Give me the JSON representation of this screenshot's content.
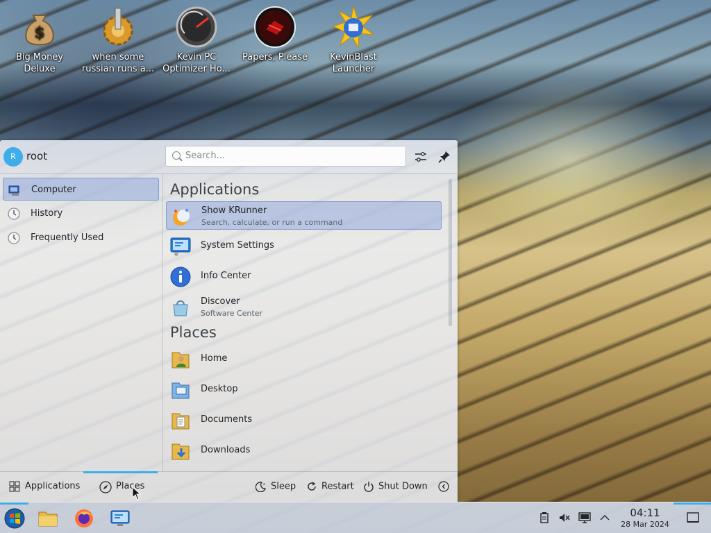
{
  "desktop": {
    "icons": [
      {
        "label_line1": "Big Money",
        "label_line2": "Deluxe",
        "icon": "money-bag-icon"
      },
      {
        "label_line1": "when some",
        "label_line2": "russian runs a...",
        "icon": "gear-hand-icon"
      },
      {
        "label_line1": "Kevin PC",
        "label_line2": "Optimizer Ho...",
        "icon": "gauge-icon"
      },
      {
        "label_line1": "Papers, Please",
        "label_line2": "",
        "icon": "papers-please-icon"
      },
      {
        "label_line1": "KevinBlast",
        "label_line2": "Launcher",
        "icon": "blast-globe-icon"
      }
    ]
  },
  "menu": {
    "user": {
      "initial": "R",
      "name": "root"
    },
    "search": {
      "placeholder": "Search..."
    },
    "sidebar": [
      {
        "label": "Computer",
        "icon": "computer-icon",
        "active": true
      },
      {
        "label": "History",
        "icon": "clock-icon",
        "active": false
      },
      {
        "label": "Frequently Used",
        "icon": "clock-icon",
        "active": false
      }
    ],
    "sections": {
      "applications": {
        "title": "Applications",
        "items": [
          {
            "title": "Show KRunner",
            "subtitle": "Search, calculate, or run a command",
            "icon": "krunner-icon",
            "active": true
          },
          {
            "title": "System Settings",
            "subtitle": "",
            "icon": "system-settings-icon",
            "active": false
          },
          {
            "title": "Info Center",
            "subtitle": "",
            "icon": "info-icon",
            "active": false
          },
          {
            "title": "Discover",
            "subtitle": "Software Center",
            "icon": "discover-icon",
            "active": false
          }
        ]
      },
      "places": {
        "title": "Places",
        "items": [
          {
            "title": "Home",
            "icon": "home-folder-icon"
          },
          {
            "title": "Desktop",
            "icon": "desktop-folder-icon"
          },
          {
            "title": "Documents",
            "icon": "documents-folder-icon"
          },
          {
            "title": "Downloads",
            "icon": "downloads-folder-icon"
          }
        ]
      }
    },
    "footer": {
      "tabs": [
        {
          "label": "Applications",
          "icon": "grid-icon",
          "active": false
        },
        {
          "label": "Places",
          "icon": "compass-icon",
          "active": true
        }
      ],
      "power": [
        {
          "label": "Sleep",
          "icon": "sleep-icon"
        },
        {
          "label": "Restart",
          "icon": "restart-icon"
        },
        {
          "label": "Shut Down",
          "icon": "power-icon"
        }
      ]
    }
  },
  "taskbar": {
    "launchers": [
      "start-orb-icon",
      "file-manager-icon",
      "firefox-icon",
      "system-settings-icon"
    ],
    "tray": [
      "clipboard-icon",
      "volume-muted-icon",
      "display-icon",
      "chevron-up-icon"
    ],
    "clock": {
      "time": "04:11",
      "date": "28 Mar 2024"
    }
  },
  "colors": {
    "accent": "#3daee9",
    "selection": "#93aadc"
  }
}
